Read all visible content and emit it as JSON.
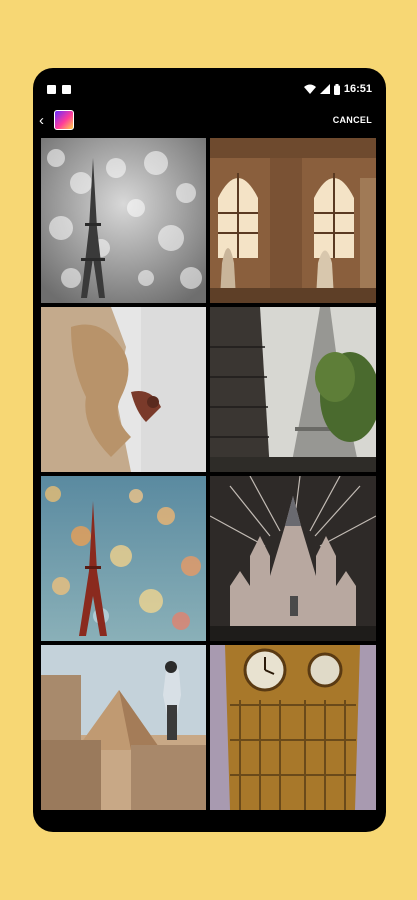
{
  "status_bar": {
    "time": "16:51",
    "icons": [
      "notification-icon",
      "notification-icon",
      "wifi-icon",
      "signal-icon",
      "battery-icon"
    ]
  },
  "app_bar": {
    "back_icon": "back-arrow-icon",
    "cancel_label": "CANCEL"
  },
  "gallery": {
    "images": [
      "eiffel-tower-bokeh-silver",
      "louvre-arched-windows-statues",
      "horse-statue-sideways",
      "eiffel-tower-street-view",
      "eiffel-tower-bokeh-colorful",
      "castle-fireworks",
      "pyramid-traveler",
      "big-ben-clock-tower"
    ]
  }
}
